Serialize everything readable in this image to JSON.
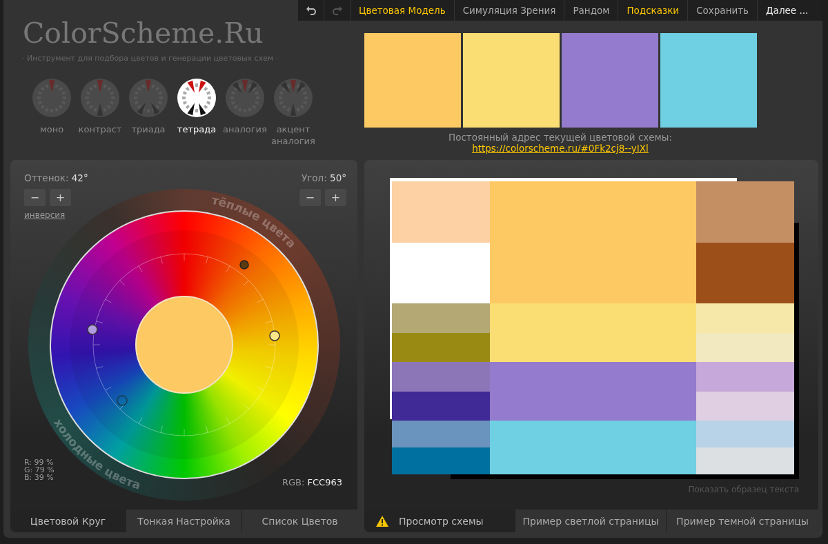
{
  "logo": {
    "title": "ColorScheme.Ru",
    "subtitle": "· Инструмент для подбора цветов и генерации цветовых схем ·"
  },
  "toolbar": {
    "undo": {
      "disabled": false
    },
    "redo": {
      "disabled": true
    },
    "items": [
      {
        "label": "Цветовая Модель",
        "highlighted": true,
        "emphasized": false
      },
      {
        "label": "Симуляция Зрения",
        "highlighted": false,
        "emphasized": false
      },
      {
        "label": "Рандом",
        "highlighted": false,
        "emphasized": false
      },
      {
        "label": "Подсказки",
        "highlighted": true,
        "emphasized": false
      },
      {
        "label": "Сохранить",
        "highlighted": false,
        "emphasized": false
      },
      {
        "label": "Далее ...",
        "highlighted": false,
        "emphasized": true
      }
    ]
  },
  "scheme_types": [
    {
      "label": "моно",
      "kind": "mono",
      "selected": false
    },
    {
      "label": "контраст",
      "kind": "contrast",
      "selected": false
    },
    {
      "label": "триада",
      "kind": "triad",
      "selected": false
    },
    {
      "label": "тетрада",
      "kind": "tetrad",
      "selected": true
    },
    {
      "label": "аналогия",
      "kind": "analog",
      "selected": false
    },
    {
      "label": "акцент аналогия",
      "kind": "accent",
      "selected": false
    }
  ],
  "swatches": [
    {
      "color": "#fcc963"
    },
    {
      "color": "#fbde73"
    },
    {
      "color": "#957bcd"
    },
    {
      "color": "#6fcfe3"
    }
  ],
  "permalink": {
    "label": "Постоянный адрес текущей цветовой схемы:",
    "url": "https://colorscheme.ru/#0Fk2cj8--yIXl"
  },
  "wheel_panel": {
    "hue_label": "Оттенок:",
    "hue": "42°",
    "angle_label": "Угол:",
    "angle": "50°",
    "minus": "−",
    "plus": "+",
    "inversion": "инверсия",
    "warm_label": "тёплые цвета",
    "cold_label": "холодные цвета",
    "rgb_percent": [
      "R: 99 %",
      "G: 79 %",
      "B: 39 %"
    ],
    "rgb_label": "RGB:",
    "rgb": "FCC963",
    "tabs": [
      {
        "label": "Цветовой Круг",
        "selected": true
      },
      {
        "label": "Тонкая Настройка",
        "selected": false
      },
      {
        "label": "Список Цветов",
        "selected": false
      }
    ]
  },
  "preview_panel": {
    "rows": [
      {
        "left": [
          {
            "color": "#fdd1a4"
          },
          {
            "color": "#ffffff"
          }
        ],
        "main": {
          "color": "#fcc963"
        },
        "right": [
          {
            "color": "#c48f62"
          },
          {
            "color": "#9c4f18"
          }
        ]
      },
      {
        "left": [
          {
            "color": "#b4a974"
          },
          {
            "color": "#998a14"
          }
        ],
        "main": {
          "color": "#fbde73"
        },
        "right": [
          {
            "color": "#f6e8a8"
          },
          {
            "color": "#f3e9c0"
          }
        ]
      },
      {
        "left": [
          {
            "color": "#8c76b8"
          },
          {
            "color": "#3f2a96"
          }
        ],
        "main": {
          "color": "#957bcd"
        },
        "right": [
          {
            "color": "#c6a8da"
          },
          {
            "color": "#e0cfe2"
          }
        ]
      },
      {
        "left": [
          {
            "color": "#6a94bd"
          },
          {
            "color": "#0070a0"
          }
        ],
        "main": {
          "color": "#6fcfe3"
        },
        "right": [
          {
            "color": "#b8d3e8"
          },
          {
            "color": "#dde0e3"
          }
        ]
      }
    ],
    "sample_text_link": "Показать образец текста",
    "tabs": [
      {
        "label": "Просмотр схемы",
        "selected": true,
        "warning": true
      },
      {
        "label": "Пример светлой страницы",
        "selected": false,
        "warning": false
      },
      {
        "label": "Пример темной страницы",
        "selected": false,
        "warning": false
      }
    ]
  }
}
